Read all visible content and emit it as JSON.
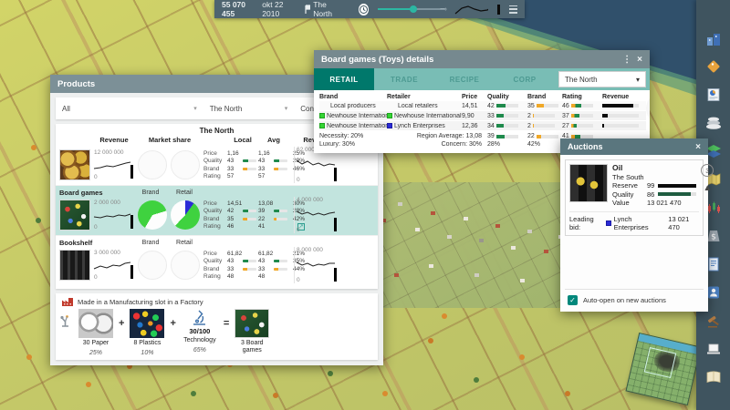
{
  "top_bar": {
    "money": "55 070 455",
    "date": "okt 22 2010",
    "region": "The North"
  },
  "products": {
    "title": "Products",
    "filter_all": "All",
    "filter_region": "The North",
    "filter_category": "Consumer",
    "region_header": "The North",
    "col_revenue": "Revenue",
    "col_market_share": "Market share",
    "col_local": "Local",
    "col_avg": "Avg",
    "col_revenue_right": "Revenue",
    "pie_brand_label": "Brand",
    "pie_retail_label": "Retail",
    "labels": {
      "price": "Price",
      "quality": "Quality",
      "brand": "Brand",
      "rating": "Rating"
    },
    "rows": [
      {
        "name": "",
        "rev_max": "12 000 000",
        "rev_min": "0",
        "price_local": "1,16",
        "price_avg": "1,16",
        "price_pct": "25%",
        "quality_local": 43,
        "quality_avg": 43,
        "quality_pct": "29%",
        "brand_local": 33,
        "brand_avg": 33,
        "brand_pct": "46%",
        "rating_local": 57,
        "rating_avg": 57,
        "rev2_max": "62 000 000",
        "rev2_min": "0"
      },
      {
        "name": "Board games",
        "rev_max": "2 000 000",
        "rev_min": "0",
        "price_local": "14,51",
        "price_avg": "13,08",
        "price_pct": "30%",
        "quality_local": 42,
        "quality_avg": 39,
        "quality_pct": "28%",
        "brand_local": 35,
        "brand_avg": 22,
        "brand_pct": "42%",
        "rating_local": 46,
        "rating_avg": 41,
        "rev2_max": "4 000 000",
        "rev2_min": "0"
      },
      {
        "name": "Bookshelf",
        "rev_max": "3 000 000",
        "rev_min": "0",
        "price_local": "61,82",
        "price_avg": "61,82",
        "price_pct": "21%",
        "quality_local": 43,
        "quality_avg": 43,
        "quality_pct": "35%",
        "brand_local": 33,
        "brand_avg": 33,
        "brand_pct": "44%",
        "rating_local": 48,
        "rating_avg": 48,
        "rev2_max": "8 000 000",
        "rev2_min": "0"
      }
    ],
    "recipe": {
      "made_in": "Made in a Manufacturing slot in a Factory",
      "plus": "+",
      "equals": "=",
      "input1": "30 Paper",
      "input1_pct": "25%",
      "input2": "8 Plastics",
      "input2_pct": "10%",
      "tech_value": "30/100",
      "input3": "Technology",
      "input3_pct": "65%",
      "output": "3 Board games"
    }
  },
  "details": {
    "title": "Board games (Toys) details",
    "tabs": {
      "retail": "RETAIL",
      "trade": "TRADE",
      "recipe": "RECIPE",
      "corp": "CORP"
    },
    "region": "The North",
    "cols": {
      "brand": "Brand",
      "retailer": "Retailer",
      "price": "Price",
      "quality": "Quality",
      "brand2": "Brand",
      "rating": "Rating",
      "revenue": "Revenue"
    },
    "rows": [
      {
        "brand": "Local producers",
        "retailer": "Local retailers",
        "price": "14,51",
        "quality": 42,
        "brand2": 35,
        "rating": 46,
        "revenue_w": 84
      },
      {
        "brand": "Newhouse International",
        "retailer": "Newhouse International",
        "price": "9,90",
        "quality": 33,
        "brand2": 2,
        "rating": 37,
        "revenue_w": 14
      },
      {
        "brand": "Newhouse International",
        "retailer": "Lynch Enterprises",
        "price": "12,36",
        "quality": 34,
        "brand2": 2,
        "rating": 27,
        "revenue_w": 4
      }
    ],
    "necessity_label": "Necessity:",
    "necessity": "20%",
    "luxury_label": "Luxury:",
    "luxury": "30%",
    "region_avg_label": "Region Average:",
    "region_avg": "13,08",
    "concern_label": "Concern:",
    "concern_price": "30%",
    "concern_quality": "28%",
    "concern_brand": "42%",
    "avg_quality": 39,
    "avg_brand": 22,
    "avg_rating": 41,
    "pie_label": "Retail"
  },
  "auctions": {
    "title": "Auctions",
    "name": "Oil",
    "region": "The South",
    "reserve_label": "Reserve",
    "reserve": 99,
    "quality_label": "Quality",
    "quality": 86,
    "value_label": "Value",
    "value": "13 021 470",
    "timer": "3",
    "leading_label": "Leading bid:",
    "bidder": "Lynch Enterprises",
    "bid": "13 021 470",
    "auto_open": "Auto-open on new auctions"
  },
  "colors": {
    "accent": "#00786b",
    "highlight": "#c2e4de",
    "pie_green": "#3fd23f",
    "pie_blue": "#2b2bd6",
    "bar_green": "#1f8a4c",
    "bar_orange": "#f0a828"
  }
}
